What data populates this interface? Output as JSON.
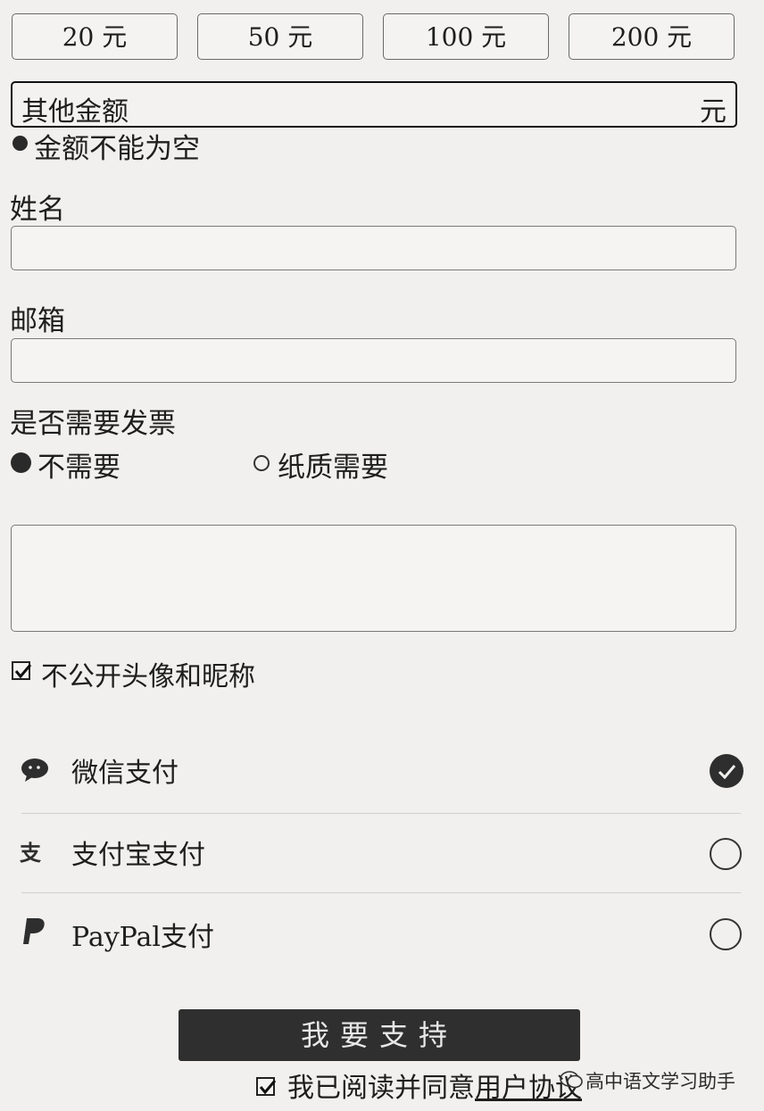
{
  "amounts": [
    {
      "label": "20 元"
    },
    {
      "label": "50 元"
    },
    {
      "label": "100 元"
    },
    {
      "label": "200 元"
    }
  ],
  "other_amount": {
    "placeholder": "其他金额",
    "unit": "元"
  },
  "error": "金额不能为空",
  "name": {
    "label": "姓名",
    "value": ""
  },
  "email": {
    "label": "邮箱",
    "value": ""
  },
  "invoice": {
    "label": "是否需要发票",
    "options": [
      {
        "label": "不需要",
        "selected": true
      },
      {
        "label": "纸质需要",
        "selected": false
      }
    ]
  },
  "message": {
    "value": ""
  },
  "anonymous": {
    "label": "不公开头像和昵称",
    "checked": true
  },
  "payment": [
    {
      "label": "微信支付",
      "icon": "wechat-icon",
      "selected": true
    },
    {
      "label": "支付宝支付",
      "icon": "alipay-icon",
      "selected": false
    },
    {
      "label": "PayPal支付",
      "icon": "paypal-icon",
      "selected": false
    }
  ],
  "submit": "我要支持",
  "agreement": {
    "prefix": "我已阅读并同意",
    "link": "用户协议",
    "checked": true
  },
  "watermark": "高中语文学习助手"
}
